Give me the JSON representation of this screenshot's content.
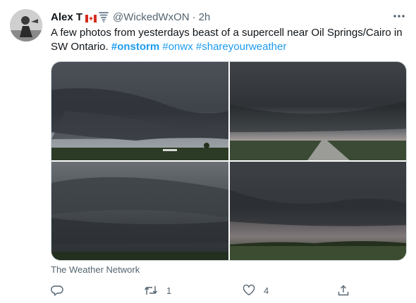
{
  "tweet": {
    "author_name": "Alex T",
    "handle": "@WickedWxON",
    "separator": "·",
    "time": "2h",
    "text_plain": "A few photos from yesterdays beast of a supercell near Oil Springs/Cairo in SW Ontario. ",
    "hashtags": [
      "#onstorm",
      "#onwx",
      "#shareyourweather"
    ],
    "media_source": "The Weather Network",
    "actions": {
      "reply_count": "",
      "retweet_count": "1",
      "like_count": "4",
      "share_count": ""
    }
  },
  "icons": {
    "flag": "canada-flag-icon",
    "tornado": "tornado-icon",
    "more": "more-dots-icon",
    "reply": "reply-icon",
    "retweet": "retweet-icon",
    "like": "heart-icon",
    "share": "share-icon"
  },
  "colors": {
    "accent": "#1d9bf0",
    "secondary_text": "#536471",
    "primary_text": "#0f1419"
  }
}
